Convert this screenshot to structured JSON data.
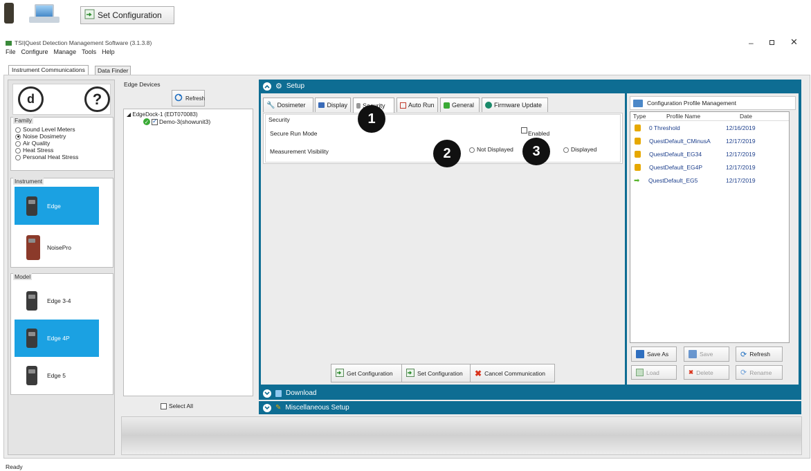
{
  "top_button": {
    "label": "Set Configuration"
  },
  "window": {
    "title": "TSI|Quest Detection Management Software (3.1.3.8)"
  },
  "menu": [
    "File",
    "Configure",
    "Manage",
    "Tools",
    "Help"
  ],
  "tabs": [
    "Instrument Communications",
    "Data Finder"
  ],
  "sidebar": {
    "family_label": "Family",
    "family_options": [
      "Sound Level Meters",
      "Noise Dosimetry",
      "Air Quality",
      "Heat Stress",
      "Personal Heat Stress"
    ],
    "family_selected": "Noise Dosimetry",
    "instrument_label": "Instrument",
    "instruments": [
      "Edge",
      "NoisePro"
    ],
    "model_label": "Model",
    "models": [
      "Edge 3-4",
      "Edge 4P",
      "Edge 5"
    ]
  },
  "devices": {
    "label": "Edge Devices",
    "refresh": "Refresh",
    "dock": "EdgeDock-1 (EDT070083)",
    "device": "Demo-3(showunit3)",
    "select_all": "Select All"
  },
  "setup": {
    "title": "Setup",
    "tabs": [
      "Dosimeter",
      "Display",
      "Security",
      "Auto Run",
      "General",
      "Firmware Update"
    ],
    "section": "Security",
    "secure_run_mode": "Secure Run Mode",
    "enabled": "Enabled",
    "measurement_visibility": "Measurement Visibility",
    "not_displayed": "Not Displayed",
    "displayed": "Displayed",
    "get_config": "Get Configuration",
    "set_config": "Set Configuration",
    "cancel": "Cancel Communication"
  },
  "callouts": [
    "1",
    "2",
    "3"
  ],
  "download": "Download",
  "misc_setup": "Miscellaneous Setup",
  "profiles": {
    "title": "Configuration Profile Management",
    "headers": [
      "Type",
      "Profile Name",
      "Date"
    ],
    "rows": [
      {
        "name": "0 Threshold",
        "date": "12/16/2019",
        "icon": "unlocked-icon"
      },
      {
        "name": "QuestDefault_CMinusA",
        "date": "12/17/2019",
        "icon": "lock-icon"
      },
      {
        "name": "QuestDefault_EG34",
        "date": "12/17/2019",
        "icon": "lock-icon"
      },
      {
        "name": "QuestDefault_EG4P",
        "date": "12/17/2019",
        "icon": "lock-icon"
      },
      {
        "name": "QuestDefault_EG5",
        "date": "12/17/2019",
        "icon": "arrow-icon"
      }
    ],
    "save_as": "Save As",
    "save": "Save",
    "refresh": "Refresh",
    "load": "Load",
    "delete": "Delete",
    "rename": "Rename"
  },
  "status": "Ready",
  "colors": {
    "accent": "#0e6d93",
    "selection": "#1ba1e2"
  }
}
